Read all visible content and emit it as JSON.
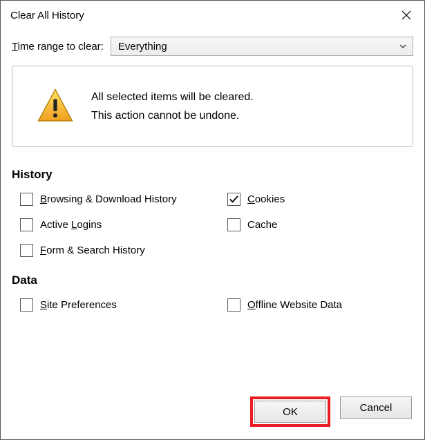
{
  "title": "Clear All History",
  "time_range": {
    "label_pre": "T",
    "label_post": "ime range to clear:",
    "selected": "Everything"
  },
  "warning": {
    "line1": "All selected items will be cleared.",
    "line2": "This action cannot be undone."
  },
  "sections": {
    "history_title": "History",
    "data_title": "Data"
  },
  "checks": {
    "browsing": {
      "pre": "B",
      "post": "rowsing & Download History",
      "checked": false
    },
    "cookies": {
      "pre": "C",
      "post": "ookies",
      "checked": true
    },
    "logins": {
      "pre": "Active ",
      "u": "L",
      "post": "ogins",
      "checked": false
    },
    "cache": {
      "pre": "C",
      "post": "ache",
      "checked": false,
      "u_first": false,
      "plain": "Cache"
    },
    "form": {
      "pre": "F",
      "post": "orm & Search History",
      "checked": false
    },
    "siteprefs": {
      "pre": "S",
      "post": "ite Preferences",
      "checked": false
    },
    "offline": {
      "pre": "O",
      "post": "ffline Website Data",
      "checked": false
    }
  },
  "buttons": {
    "ok": "OK",
    "cancel": "Cancel"
  }
}
